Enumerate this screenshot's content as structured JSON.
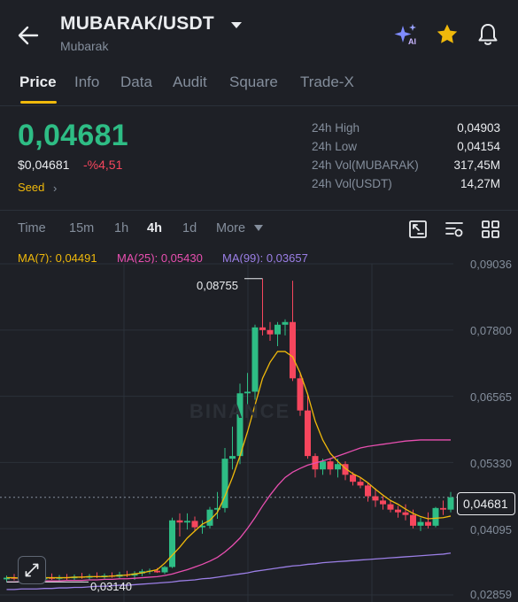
{
  "header": {
    "pair": "MUBARAK/USDT",
    "subname": "Mubarak"
  },
  "tabs": [
    "Price",
    "Info",
    "Data",
    "Audit",
    "Square",
    "Trade-X"
  ],
  "active_tab": "Price",
  "ticker": {
    "last_price": "0,04681",
    "usd_price": "$0,04681",
    "change": "-%4,51",
    "tag": "Seed",
    "tag_chevron": "›"
  },
  "stats": [
    {
      "label": "24h High",
      "value": "0,04903"
    },
    {
      "label": "24h Low",
      "value": "0,04154"
    },
    {
      "label": "24h Vol(MUBARAK)",
      "value": "317,45M"
    },
    {
      "label": "24h Vol(USDT)",
      "value": "14,27M"
    }
  ],
  "timeframes": [
    "Time",
    "15m",
    "1h",
    "4h",
    "1d",
    "More"
  ],
  "active_timeframe": "4h",
  "moving_averages": [
    {
      "label": "MA(7): 0,04491",
      "color": "#f0b90b"
    },
    {
      "label": "MA(25): 0,05430",
      "color": "#e84fb0"
    },
    {
      "label": "MA(99): 0,03657",
      "color": "#9b7fe6"
    }
  ],
  "chart": {
    "price_axis": [
      "0,09036",
      "0,07800",
      "0,06565",
      "0,05330",
      "0,04095",
      "0,02859"
    ],
    "current_price_tag": "0,04681",
    "high_marker": "0,08755",
    "low_marker": "0,03140",
    "watermark": "BINANCE"
  },
  "colors": {
    "up": "#2ebd85",
    "down": "#f6465d",
    "accent": "#f0b90b",
    "background": "#1e2026"
  },
  "icons": {
    "back": "arrow-left-icon",
    "pair_menu": "caret-down-icon",
    "ai": "ai-sparkle-icon",
    "favorite": "star-icon",
    "alerts": "bell-icon",
    "depth": "chart-depth-icon",
    "indicators": "indicator-settings-icon",
    "layout": "grid-layout-icon",
    "expand": "expand-icon"
  },
  "chart_data": {
    "type": "candlestick",
    "interval": "4h",
    "ylim": [
      0.02859,
      0.09036
    ],
    "y_ticks": [
      0.09036,
      0.078,
      0.06565,
      0.0533,
      0.04095,
      0.02859
    ],
    "grid": true,
    "candles": [
      {
        "o": 0.0315,
        "h": 0.0322,
        "l": 0.031,
        "c": 0.0318
      },
      {
        "o": 0.0318,
        "h": 0.0325,
        "l": 0.0313,
        "c": 0.0316
      },
      {
        "o": 0.0316,
        "h": 0.0323,
        "l": 0.0311,
        "c": 0.0314
      },
      {
        "o": 0.0314,
        "h": 0.0321,
        "l": 0.031,
        "c": 0.0317
      },
      {
        "o": 0.0317,
        "h": 0.0324,
        "l": 0.0313,
        "c": 0.0315
      },
      {
        "o": 0.0315,
        "h": 0.0322,
        "l": 0.0311,
        "c": 0.0318
      },
      {
        "o": 0.0318,
        "h": 0.0326,
        "l": 0.0314,
        "c": 0.0316
      },
      {
        "o": 0.0316,
        "h": 0.0323,
        "l": 0.0312,
        "c": 0.0319
      },
      {
        "o": 0.0319,
        "h": 0.0325,
        "l": 0.0314,
        "c": 0.0317
      },
      {
        "o": 0.0317,
        "h": 0.0324,
        "l": 0.0314,
        "c": 0.032
      },
      {
        "o": 0.032,
        "h": 0.0327,
        "l": 0.0316,
        "c": 0.0318
      },
      {
        "o": 0.0318,
        "h": 0.0325,
        "l": 0.0315,
        "c": 0.0321
      },
      {
        "o": 0.0321,
        "h": 0.0328,
        "l": 0.0317,
        "c": 0.0319
      },
      {
        "o": 0.0319,
        "h": 0.0326,
        "l": 0.0316,
        "c": 0.0322
      },
      {
        "o": 0.0322,
        "h": 0.0328,
        "l": 0.0318,
        "c": 0.032
      },
      {
        "o": 0.032,
        "h": 0.0329,
        "l": 0.0317,
        "c": 0.0324
      },
      {
        "o": 0.0324,
        "h": 0.0331,
        "l": 0.0319,
        "c": 0.0322
      },
      {
        "o": 0.0322,
        "h": 0.033,
        "l": 0.0314,
        "c": 0.0326
      },
      {
        "o": 0.0326,
        "h": 0.0334,
        "l": 0.0321,
        "c": 0.033
      },
      {
        "o": 0.033,
        "h": 0.0335,
        "l": 0.0325,
        "c": 0.0331
      },
      {
        "o": 0.0331,
        "h": 0.0336,
        "l": 0.0327,
        "c": 0.0328
      },
      {
        "o": 0.0328,
        "h": 0.034,
        "l": 0.0325,
        "c": 0.0338
      },
      {
        "o": 0.0338,
        "h": 0.043,
        "l": 0.0336,
        "c": 0.0425
      },
      {
        "o": 0.0425,
        "h": 0.0438,
        "l": 0.0395,
        "c": 0.0421
      },
      {
        "o": 0.0421,
        "h": 0.0438,
        "l": 0.0408,
        "c": 0.0424
      },
      {
        "o": 0.0424,
        "h": 0.0432,
        "l": 0.0405,
        "c": 0.0412
      },
      {
        "o": 0.0412,
        "h": 0.0425,
        "l": 0.04,
        "c": 0.0415
      },
      {
        "o": 0.0415,
        "h": 0.045,
        "l": 0.041,
        "c": 0.0445
      },
      {
        "o": 0.0445,
        "h": 0.0478,
        "l": 0.0428,
        "c": 0.0448
      },
      {
        "o": 0.0448,
        "h": 0.056,
        "l": 0.044,
        "c": 0.054
      },
      {
        "o": 0.054,
        "h": 0.06,
        "l": 0.052,
        "c": 0.0545
      },
      {
        "o": 0.0545,
        "h": 0.068,
        "l": 0.053,
        "c": 0.0662
      },
      {
        "o": 0.0662,
        "h": 0.07,
        "l": 0.064,
        "c": 0.0665
      },
      {
        "o": 0.0665,
        "h": 0.079,
        "l": 0.065,
        "c": 0.0785
      },
      {
        "o": 0.0785,
        "h": 0.0876,
        "l": 0.077,
        "c": 0.078
      },
      {
        "o": 0.078,
        "h": 0.0795,
        "l": 0.076,
        "c": 0.0772
      },
      {
        "o": 0.0772,
        "h": 0.0795,
        "l": 0.075,
        "c": 0.079
      },
      {
        "o": 0.079,
        "h": 0.08,
        "l": 0.077,
        "c": 0.0795
      },
      {
        "o": 0.0795,
        "h": 0.0872,
        "l": 0.0685,
        "c": 0.069
      },
      {
        "o": 0.069,
        "h": 0.07,
        "l": 0.062,
        "c": 0.063
      },
      {
        "o": 0.063,
        "h": 0.066,
        "l": 0.054,
        "c": 0.0545
      },
      {
        "o": 0.0545,
        "h": 0.055,
        "l": 0.0505,
        "c": 0.052
      },
      {
        "o": 0.052,
        "h": 0.054,
        "l": 0.051,
        "c": 0.0535
      },
      {
        "o": 0.0535,
        "h": 0.054,
        "l": 0.051,
        "c": 0.052
      },
      {
        "o": 0.052,
        "h": 0.054,
        "l": 0.0505,
        "c": 0.053
      },
      {
        "o": 0.053,
        "h": 0.0535,
        "l": 0.05,
        "c": 0.051
      },
      {
        "o": 0.051,
        "h": 0.0515,
        "l": 0.049,
        "c": 0.0497
      },
      {
        "o": 0.0497,
        "h": 0.0505,
        "l": 0.0485,
        "c": 0.049
      },
      {
        "o": 0.049,
        "h": 0.0495,
        "l": 0.046,
        "c": 0.047
      },
      {
        "o": 0.047,
        "h": 0.0485,
        "l": 0.045,
        "c": 0.0462
      },
      {
        "o": 0.0462,
        "h": 0.047,
        "l": 0.0445,
        "c": 0.0455
      },
      {
        "o": 0.0455,
        "h": 0.0462,
        "l": 0.044,
        "c": 0.0445
      },
      {
        "o": 0.0445,
        "h": 0.0452,
        "l": 0.043,
        "c": 0.044
      },
      {
        "o": 0.044,
        "h": 0.0455,
        "l": 0.0425,
        "c": 0.0435
      },
      {
        "o": 0.0435,
        "h": 0.0445,
        "l": 0.041,
        "c": 0.0415
      },
      {
        "o": 0.0415,
        "h": 0.043,
        "l": 0.0405,
        "c": 0.0422
      },
      {
        "o": 0.0422,
        "h": 0.044,
        "l": 0.041,
        "c": 0.0415
      },
      {
        "o": 0.0415,
        "h": 0.045,
        "l": 0.0412,
        "c": 0.0448
      },
      {
        "o": 0.0448,
        "h": 0.0462,
        "l": 0.0435,
        "c": 0.0445
      },
      {
        "o": 0.0445,
        "h": 0.0478,
        "l": 0.044,
        "c": 0.0468
      }
    ],
    "ma7": [
      0.0318,
      0.0318,
      0.0317,
      0.0317,
      0.0317,
      0.0318,
      0.0318,
      0.0318,
      0.0318,
      0.0319,
      0.0319,
      0.032,
      0.032,
      0.032,
      0.0321,
      0.0322,
      0.0323,
      0.0325,
      0.0327,
      0.033,
      0.0333,
      0.0345,
      0.036,
      0.0375,
      0.0392,
      0.0405,
      0.0418,
      0.0425,
      0.044,
      0.047,
      0.0505,
      0.0545,
      0.059,
      0.064,
      0.069,
      0.072,
      0.074,
      0.074,
      0.073,
      0.07,
      0.066,
      0.061,
      0.0575,
      0.055,
      0.0535,
      0.0522,
      0.0512,
      0.0505,
      0.0495,
      0.0483,
      0.0472,
      0.0462,
      0.0455,
      0.0446,
      0.0438,
      0.0432,
      0.0428,
      0.0429,
      0.043,
      0.0433
    ],
    "ma25": [
      0.031,
      0.031,
      0.0311,
      0.0311,
      0.0311,
      0.0312,
      0.0312,
      0.0312,
      0.0313,
      0.0313,
      0.0313,
      0.0314,
      0.0314,
      0.0315,
      0.0315,
      0.0316,
      0.0316,
      0.0317,
      0.0318,
      0.0319,
      0.032,
      0.0322,
      0.0325,
      0.0329,
      0.0333,
      0.0338,
      0.0343,
      0.0349,
      0.0356,
      0.0366,
      0.0378,
      0.0392,
      0.041,
      0.043,
      0.0452,
      0.0472,
      0.049,
      0.0505,
      0.0515,
      0.0522,
      0.0528,
      0.0532,
      0.0536,
      0.054,
      0.0545,
      0.055,
      0.0555,
      0.056,
      0.0563,
      0.0565,
      0.0567,
      0.0569,
      0.0571,
      0.0573,
      0.0574,
      0.0575,
      0.0575,
      0.0575,
      0.0575,
      0.0575
    ],
    "ma99": [
      0.0296,
      0.0296,
      0.0297,
      0.0297,
      0.0297,
      0.0298,
      0.0298,
      0.0299,
      0.0299,
      0.03,
      0.03,
      0.0301,
      0.0302,
      0.0302,
      0.0303,
      0.0304,
      0.0304,
      0.0305,
      0.0306,
      0.0307,
      0.0308,
      0.0309,
      0.031,
      0.0312,
      0.0313,
      0.0314,
      0.0316,
      0.0317,
      0.0319,
      0.0321,
      0.0323,
      0.0325,
      0.0327,
      0.033,
      0.0332,
      0.0334,
      0.0336,
      0.0338,
      0.034,
      0.0341,
      0.0343,
      0.0344,
      0.0346,
      0.0347,
      0.0348,
      0.0349,
      0.035,
      0.0351,
      0.0352,
      0.0353,
      0.0354,
      0.0355,
      0.0356,
      0.0357,
      0.0358,
      0.0359,
      0.036,
      0.0361,
      0.0362,
      0.0364
    ]
  }
}
